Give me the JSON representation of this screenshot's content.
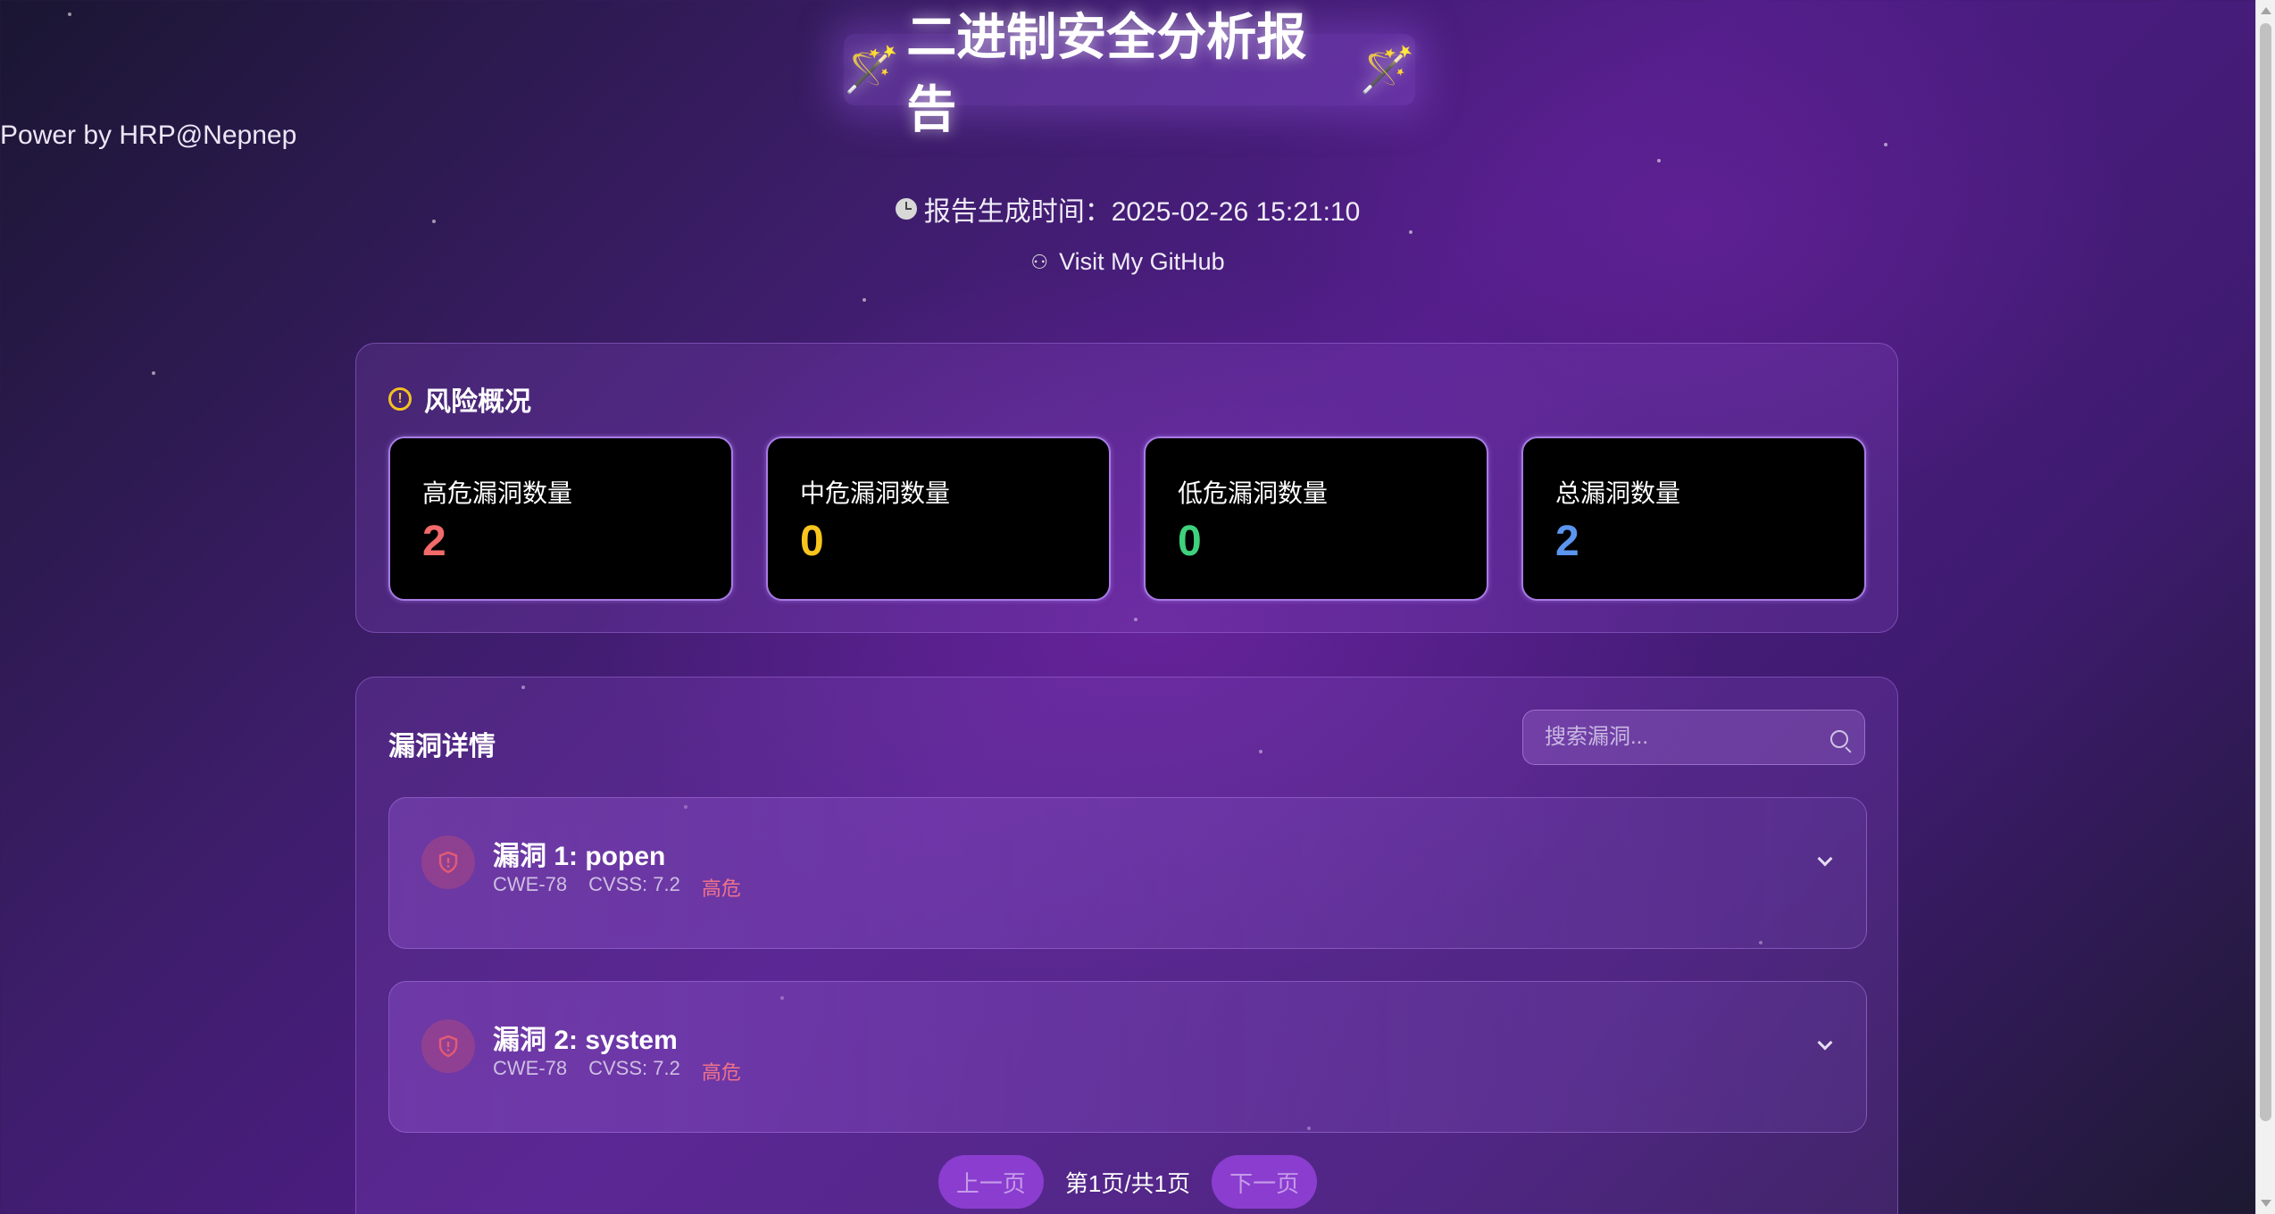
{
  "header": {
    "title": "二进制安全分析报告",
    "subtitle": "Power by HRP@Nepnep",
    "generated_time": "报告生成时间：2025-02-26 15:21:10",
    "github_link": "Visit My GitHub"
  },
  "overview": {
    "title": "风险概况",
    "cards": [
      {
        "label": "高危漏洞数量",
        "value": "2",
        "color": "#f26a6a"
      },
      {
        "label": "中危漏洞数量",
        "value": "0",
        "color": "#f7c51d"
      },
      {
        "label": "低危漏洞数量",
        "value": "0",
        "color": "#3ed27c"
      },
      {
        "label": "总漏洞数量",
        "value": "2",
        "color": "#5b95f0"
      }
    ]
  },
  "details": {
    "title": "漏洞详情",
    "search_placeholder": "搜索漏洞...",
    "vulns": [
      {
        "title": "漏洞 1: popen",
        "cwe": "CWE-78",
        "cvss": "CVSS: 7.2",
        "severity": "高危"
      },
      {
        "title": "漏洞 2: system",
        "cwe": "CWE-78",
        "cvss": "CVSS: 7.2",
        "severity": "高危"
      }
    ],
    "pagination": {
      "prev": "上一页",
      "info": "第1页/共1页",
      "next": "下一页"
    }
  },
  "colors": {
    "accent": "#8b3dd0",
    "card_border": "#a77be6",
    "severity_high": "#f0738a"
  }
}
